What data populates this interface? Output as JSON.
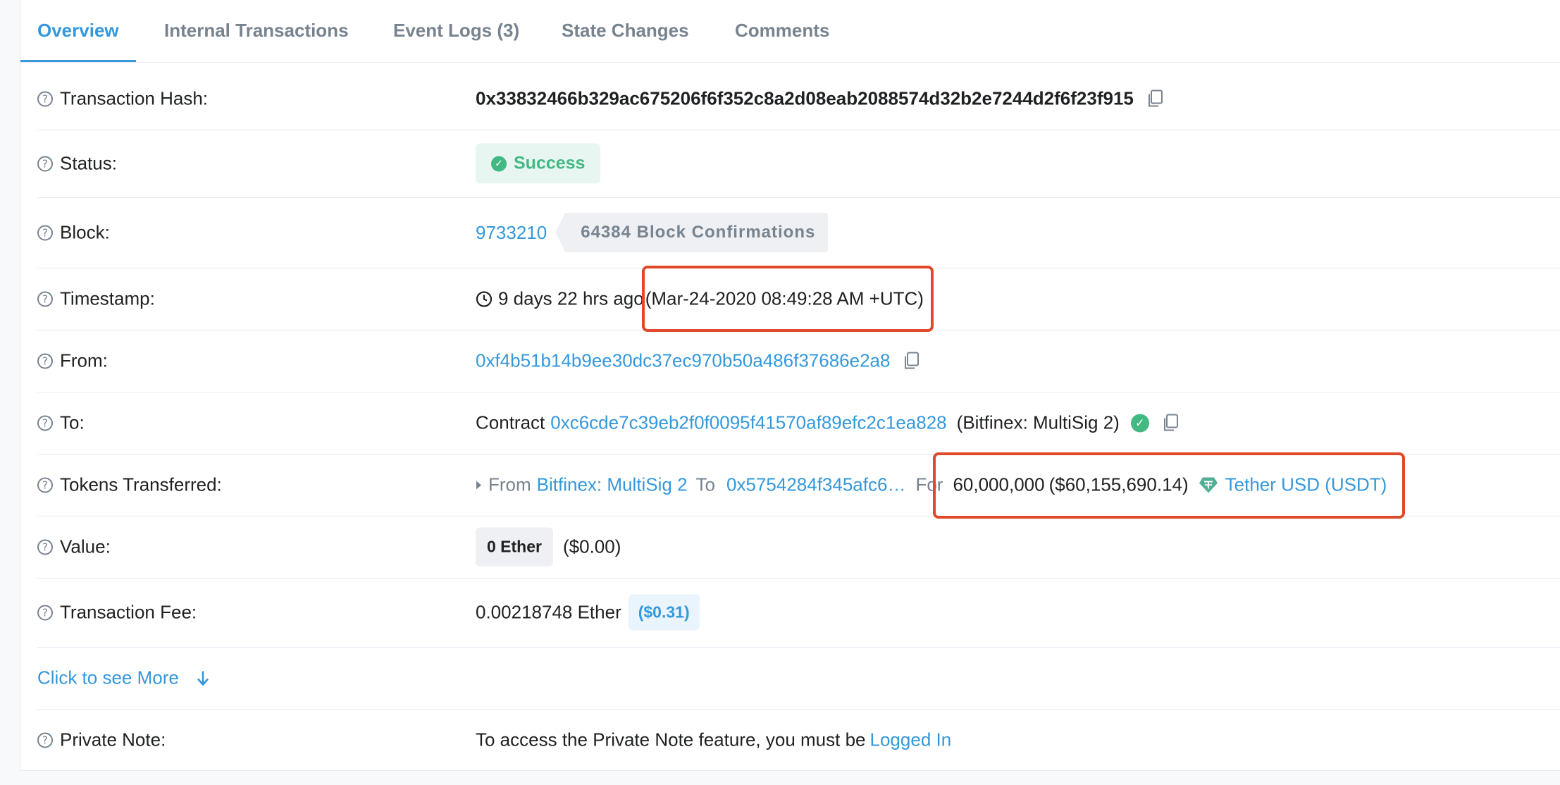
{
  "tabs": [
    {
      "label": "Overview",
      "active": true
    },
    {
      "label": "Internal Transactions"
    },
    {
      "label": "Event Logs (3)"
    },
    {
      "label": "State Changes"
    },
    {
      "label": "Comments"
    }
  ],
  "rows": {
    "hash": {
      "label": "Transaction Hash:",
      "value": "0x33832466b329ac675206f6f352c8a2d08eab2088574d32b2e7244d2f6f23f915"
    },
    "status": {
      "label": "Status:",
      "value": "Success"
    },
    "block": {
      "label": "Block:",
      "value": "9733210",
      "confirmations": "64384 Block Confirmations"
    },
    "timestamp": {
      "label": "Timestamp:",
      "ago": "9 days 22 hrs ago",
      "datetime": "(Mar-24-2020 08:49:28 AM +UTC)"
    },
    "from": {
      "label": "From:",
      "value": "0xf4b51b14b9ee30dc37ec970b50a486f37686e2a8"
    },
    "to": {
      "label": "To:",
      "prefix": "Contract",
      "address": "0xc6cde7c39eb2f0f0095f41570af89efc2c1ea828",
      "name": "(Bitfinex: MultiSig 2)"
    },
    "tokens": {
      "label": "Tokens Transferred:",
      "from_word": "From",
      "from_name": "Bitfinex: MultiSig 2",
      "to_word": "To",
      "to_address": "0x5754284f345afc6…",
      "for_word": "For",
      "amount": "60,000,000",
      "usd": "($60,155,690.14)",
      "token": "Tether USD (USDT)"
    },
    "value": {
      "label": "Value:",
      "ether": "0 Ether",
      "usd": "($0.00)"
    },
    "fee": {
      "label": "Transaction Fee:",
      "ether": "0.00218748 Ether",
      "usd": "($0.31)"
    },
    "more": {
      "label": "Click to see More"
    },
    "note": {
      "label": "Private Note:",
      "text": "To access the Private Note feature, you must be",
      "link": "Logged In"
    }
  },
  "colors": {
    "accent": "#3498db",
    "success": "#42b983",
    "highlight": "#e04a2b",
    "tether": "#50af95"
  }
}
